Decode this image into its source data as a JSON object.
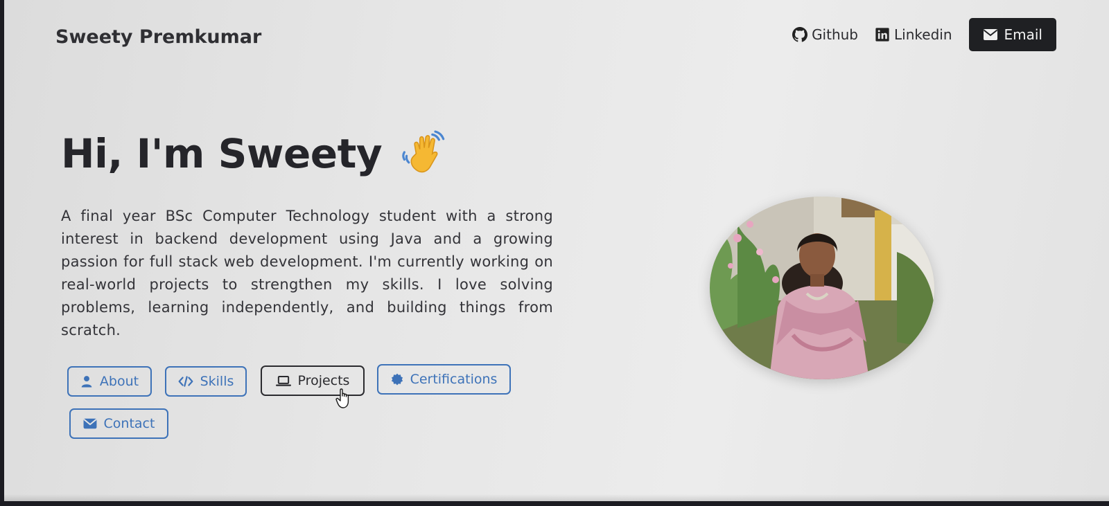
{
  "header": {
    "brand": "Sweety Premkumar",
    "nav": {
      "github_label": "Github",
      "linkedin_label": "Linkedin",
      "email_label": "Email"
    }
  },
  "hero": {
    "title": "Hi, I'm Sweety",
    "wave_icon": "waving-hand-emoji",
    "bio": "A final year BSc Computer Technology student with a strong interest in backend development using Java and a growing passion for full stack web development. I'm currently working on real-world projects to strengthen my skills. I love solving problems, learning independently, and building things from scratch."
  },
  "buttons": {
    "about": "About",
    "skills": "Skills",
    "projects": "Projects",
    "certifications": "Certifications",
    "contact": "Contact"
  },
  "colors": {
    "accent": "#3d72b8",
    "dark": "#1f2023",
    "background": "#e6e6e6"
  },
  "icons": [
    "github-icon",
    "linkedin-icon",
    "envelope-icon",
    "user-icon",
    "code-icon",
    "laptop-icon",
    "badge-icon",
    "hand-pointer-cursor"
  ]
}
